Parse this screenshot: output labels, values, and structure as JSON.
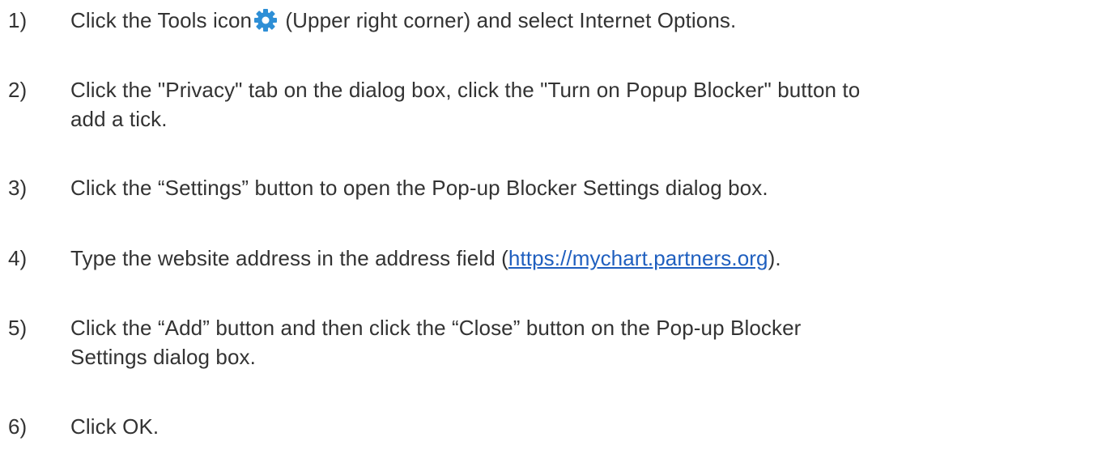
{
  "accent_colors": {
    "text": "#333333",
    "link": "#1f5fbf",
    "gear_icon": "#2e8fd6"
  },
  "steps": [
    {
      "number": "1)",
      "before_icon": "Click the Tools icon",
      "icon": "gear-icon",
      "after_icon": " (Upper right corner) and select Internet Options."
    },
    {
      "number": "2)",
      "line1": "Click the \"Privacy\" tab on the dialog box, click the \"Turn on Popup Blocker\" button to",
      "line2": "add a tick."
    },
    {
      "number": "3)",
      "line1": "Click the “Settings” button to open the Pop-up Blocker Settings dialog box."
    },
    {
      "number": "4)",
      "before_link": "Type the website address in the address field (",
      "link": "https://mychart.partners.org",
      "after_link": ")."
    },
    {
      "number": "5)",
      "line1": "Click the “Add” button and then click the “Close” button on the Pop-up Blocker",
      "line2": "Settings dialog box."
    },
    {
      "number": "6)",
      "line1": "Click OK."
    }
  ]
}
